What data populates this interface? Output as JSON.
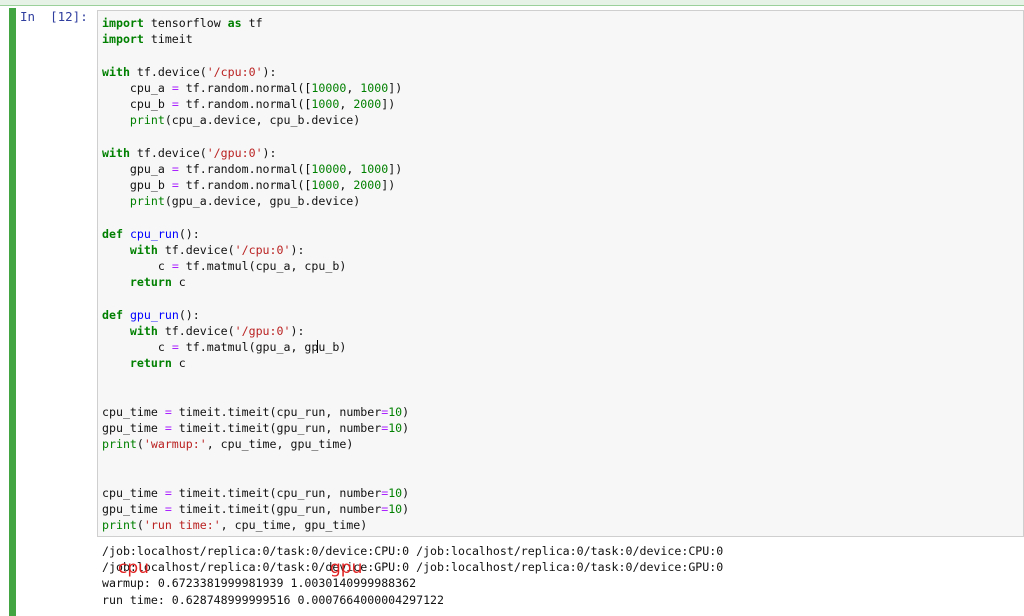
{
  "cell": {
    "prompt": "In  [12]:",
    "code_lines": [
      [
        {
          "t": "import",
          "c": "kw"
        },
        {
          "t": " tensorflow "
        },
        {
          "t": "as",
          "c": "kw"
        },
        {
          "t": " tf"
        }
      ],
      [
        {
          "t": "import",
          "c": "kw"
        },
        {
          "t": " timeit"
        }
      ],
      [],
      [
        {
          "t": "with",
          "c": "kw"
        },
        {
          "t": " tf.device("
        },
        {
          "t": "'/cpu:0'",
          "c": "str"
        },
        {
          "t": "):"
        }
      ],
      [
        {
          "t": "    cpu_a "
        },
        {
          "t": "=",
          "c": "op"
        },
        {
          "t": " tf.random.normal(["
        },
        {
          "t": "10000",
          "c": "num"
        },
        {
          "t": ", "
        },
        {
          "t": "1000",
          "c": "num"
        },
        {
          "t": "])"
        }
      ],
      [
        {
          "t": "    cpu_b "
        },
        {
          "t": "=",
          "c": "op"
        },
        {
          "t": " tf.random.normal(["
        },
        {
          "t": "1000",
          "c": "num"
        },
        {
          "t": ", "
        },
        {
          "t": "2000",
          "c": "num"
        },
        {
          "t": "])"
        }
      ],
      [
        {
          "t": "    "
        },
        {
          "t": "print",
          "c": "bi"
        },
        {
          "t": "(cpu_a.device, cpu_b.device)"
        }
      ],
      [],
      [
        {
          "t": "with",
          "c": "kw"
        },
        {
          "t": " tf.device("
        },
        {
          "t": "'/gpu:0'",
          "c": "str"
        },
        {
          "t": "):"
        }
      ],
      [
        {
          "t": "    gpu_a "
        },
        {
          "t": "=",
          "c": "op"
        },
        {
          "t": " tf.random.normal(["
        },
        {
          "t": "10000",
          "c": "num"
        },
        {
          "t": ", "
        },
        {
          "t": "1000",
          "c": "num"
        },
        {
          "t": "])"
        }
      ],
      [
        {
          "t": "    gpu_b "
        },
        {
          "t": "=",
          "c": "op"
        },
        {
          "t": " tf.random.normal(["
        },
        {
          "t": "1000",
          "c": "num"
        },
        {
          "t": ", "
        },
        {
          "t": "2000",
          "c": "num"
        },
        {
          "t": "])"
        }
      ],
      [
        {
          "t": "    "
        },
        {
          "t": "print",
          "c": "bi"
        },
        {
          "t": "(gpu_a.device, gpu_b.device)"
        }
      ],
      [],
      [
        {
          "t": "def",
          "c": "kw"
        },
        {
          "t": " "
        },
        {
          "t": "cpu_run",
          "c": "fn"
        },
        {
          "t": "():"
        }
      ],
      [
        {
          "t": "    "
        },
        {
          "t": "with",
          "c": "kw"
        },
        {
          "t": " tf.device("
        },
        {
          "t": "'/cpu:0'",
          "c": "str"
        },
        {
          "t": "):"
        }
      ],
      [
        {
          "t": "        c "
        },
        {
          "t": "=",
          "c": "op"
        },
        {
          "t": " tf.matmul(cpu_a, cpu_b)"
        }
      ],
      [
        {
          "t": "    "
        },
        {
          "t": "return",
          "c": "kw"
        },
        {
          "t": " c"
        }
      ],
      [],
      [
        {
          "t": "def",
          "c": "kw"
        },
        {
          "t": " "
        },
        {
          "t": "gpu_run",
          "c": "fn"
        },
        {
          "t": "():"
        }
      ],
      [
        {
          "t": "    "
        },
        {
          "t": "with",
          "c": "kw"
        },
        {
          "t": " tf.device("
        },
        {
          "t": "'/gpu:0'",
          "c": "str"
        },
        {
          "t": "):"
        }
      ],
      [
        {
          "t": "        c "
        },
        {
          "t": "=",
          "c": "op"
        },
        {
          "t": " tf.matmul(gpu_a, gp"
        },
        {
          "t": "",
          "c": "cursor"
        },
        {
          "t": "u_b)"
        }
      ],
      [
        {
          "t": "    "
        },
        {
          "t": "return",
          "c": "kw"
        },
        {
          "t": " c"
        }
      ],
      [],
      [],
      [
        {
          "t": "cpu_time "
        },
        {
          "t": "=",
          "c": "op"
        },
        {
          "t": " timeit.timeit(cpu_run, number"
        },
        {
          "t": "=",
          "c": "op"
        },
        {
          "t": "10",
          "c": "num"
        },
        {
          "t": ")"
        }
      ],
      [
        {
          "t": "gpu_time "
        },
        {
          "t": "=",
          "c": "op"
        },
        {
          "t": " timeit.timeit(gpu_run, number"
        },
        {
          "t": "=",
          "c": "op"
        },
        {
          "t": "10",
          "c": "num"
        },
        {
          "t": ")"
        }
      ],
      [
        {
          "t": "print",
          "c": "bi"
        },
        {
          "t": "("
        },
        {
          "t": "'warmup:'",
          "c": "str"
        },
        {
          "t": ", cpu_time, gpu_time)"
        }
      ],
      [],
      [],
      [
        {
          "t": "cpu_time "
        },
        {
          "t": "=",
          "c": "op"
        },
        {
          "t": " timeit.timeit(cpu_run, number"
        },
        {
          "t": "=",
          "c": "op"
        },
        {
          "t": "10",
          "c": "num"
        },
        {
          "t": ")"
        }
      ],
      [
        {
          "t": "gpu_time "
        },
        {
          "t": "=",
          "c": "op"
        },
        {
          "t": " timeit.timeit(gpu_run, number"
        },
        {
          "t": "=",
          "c": "op"
        },
        {
          "t": "10",
          "c": "num"
        },
        {
          "t": ")"
        }
      ],
      [
        {
          "t": "print",
          "c": "bi"
        },
        {
          "t": "("
        },
        {
          "t": "'run time:'",
          "c": "str"
        },
        {
          "t": ", cpu_time, gpu_time)"
        }
      ]
    ],
    "output_lines": [
      "/job:localhost/replica:0/task:0/device:CPU:0 /job:localhost/replica:0/task:0/device:CPU:0",
      "/job:localhost/replica:0/task:0/device:GPU:0 /job:localhost/replica:0/task:0/device:GPU:0",
      "warmup: 0.6723381999981939 1.0030140999988362",
      "run time: 0.628748999999516 0.0007664000004297122"
    ],
    "annotations": {
      "cpu": "cpu",
      "gpu": "gpu"
    }
  },
  "colors": {
    "cell_bar": "#42a542",
    "prompt": "#303f9f",
    "keyword": "#008000",
    "string": "#ba2121",
    "annotation": "#e02020"
  }
}
